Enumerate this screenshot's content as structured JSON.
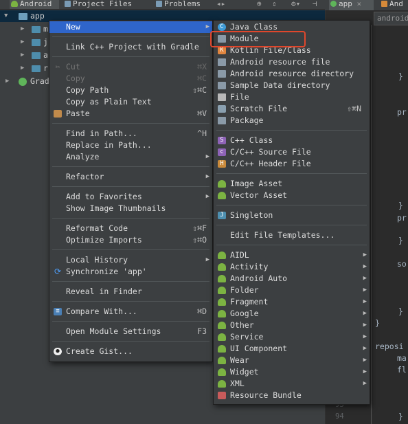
{
  "top_tabs": {
    "android": "Android",
    "project_files": "Project Files",
    "problems": "Problems",
    "editor_app": "app",
    "editor_and": "And"
  },
  "tree": {
    "root": "app",
    "items": [
      "m",
      "j",
      "a",
      "r"
    ],
    "gradle": "Grad"
  },
  "editor": {
    "breadcrumb": "android",
    "code_pr1": "pr",
    "code_pr2": "pr",
    "code_so": "so",
    "code_reposi": "reposi",
    "code_ma": "ma",
    "code_fl": "fl",
    "brace": "}",
    "line_93": "93",
    "line_94": "94"
  },
  "main_menu": [
    {
      "label": "New",
      "shortcut": "",
      "submenu": true,
      "selected": true
    },
    {
      "sep": true
    },
    {
      "label": "Link C++ Project with Gradle"
    },
    {
      "sep": true
    },
    {
      "label": "Cut",
      "shortcut": "⌘X",
      "disabled": true,
      "icon": "cut-icon"
    },
    {
      "label": "Copy",
      "shortcut": "⌘C",
      "disabled": true
    },
    {
      "label": "Copy Path",
      "shortcut": "⇧⌘C"
    },
    {
      "label": "Copy as Plain Text"
    },
    {
      "label": "Paste",
      "shortcut": "⌘V",
      "icon": "paste-icon"
    },
    {
      "sep": true
    },
    {
      "label": "Find in Path...",
      "shortcut": "^H"
    },
    {
      "label": "Replace in Path..."
    },
    {
      "label": "Analyze",
      "submenu": true
    },
    {
      "sep": true
    },
    {
      "label": "Refactor",
      "submenu": true
    },
    {
      "sep": true
    },
    {
      "label": "Add to Favorites",
      "submenu": true
    },
    {
      "label": "Show Image Thumbnails"
    },
    {
      "sep": true
    },
    {
      "label": "Reformat Code",
      "shortcut": "⇧⌘F"
    },
    {
      "label": "Optimize Imports",
      "shortcut": "⇧⌘O"
    },
    {
      "sep": true
    },
    {
      "label": "Local History",
      "submenu": true
    },
    {
      "label": "Synchronize 'app'",
      "icon": "sync-icon"
    },
    {
      "sep": true
    },
    {
      "label": "Reveal in Finder"
    },
    {
      "sep": true
    },
    {
      "label": "Compare With...",
      "shortcut": "⌘D",
      "icon": "compare-icon"
    },
    {
      "sep": true
    },
    {
      "label": "Open Module Settings",
      "shortcut": "F3"
    },
    {
      "sep": true
    },
    {
      "label": "Create Gist...",
      "icon": "github-icon"
    }
  ],
  "new_menu": [
    {
      "label": "Java Class",
      "icon": "java-class-icon"
    },
    {
      "label": "Module",
      "icon": "module-icon",
      "highlighted": true
    },
    {
      "label": "Kotlin File/Class",
      "icon": "kotlin-icon"
    },
    {
      "label": "Android resource file",
      "icon": "android-resource-file-icon"
    },
    {
      "label": "Android resource directory",
      "icon": "folder-icon"
    },
    {
      "label": "Sample Data directory",
      "icon": "folder-icon"
    },
    {
      "label": "File",
      "icon": "file-icon"
    },
    {
      "label": "Scratch File",
      "shortcut": "⇧⌘N",
      "icon": "scratch-icon"
    },
    {
      "label": "Package",
      "icon": "package-icon"
    },
    {
      "sep": true
    },
    {
      "label": "C++ Class",
      "icon": "cpp-class-icon"
    },
    {
      "label": "C/C++ Source File",
      "icon": "cpp-source-icon"
    },
    {
      "label": "C/C++ Header File",
      "icon": "header-icon"
    },
    {
      "sep": true
    },
    {
      "label": "Image Asset",
      "icon": "android-icon"
    },
    {
      "label": "Vector Asset",
      "icon": "android-icon"
    },
    {
      "sep": true
    },
    {
      "label": "Singleton",
      "icon": "singleton-icon"
    },
    {
      "sep": true
    },
    {
      "label": "Edit File Templates..."
    },
    {
      "sep": true
    },
    {
      "label": "AIDL",
      "submenu": true,
      "icon": "android-icon"
    },
    {
      "label": "Activity",
      "submenu": true,
      "icon": "android-icon"
    },
    {
      "label": "Android Auto",
      "submenu": true,
      "icon": "android-icon"
    },
    {
      "label": "Folder",
      "submenu": true,
      "icon": "android-icon"
    },
    {
      "label": "Fragment",
      "submenu": true,
      "icon": "android-icon"
    },
    {
      "label": "Google",
      "submenu": true,
      "icon": "android-icon"
    },
    {
      "label": "Other",
      "submenu": true,
      "icon": "android-icon"
    },
    {
      "label": "Service",
      "submenu": true,
      "icon": "android-icon"
    },
    {
      "label": "UI Component",
      "submenu": true,
      "icon": "android-icon"
    },
    {
      "label": "Wear",
      "submenu": true,
      "icon": "android-icon"
    },
    {
      "label": "Widget",
      "submenu": true,
      "icon": "android-icon"
    },
    {
      "label": "XML",
      "submenu": true,
      "icon": "android-icon"
    },
    {
      "label": "Resource Bundle",
      "icon": "resource-bundle-icon"
    }
  ],
  "colors": {
    "selection": "#2f65ca",
    "highlight_box": "#e0472c",
    "menu_bg": "#3c3f41"
  }
}
